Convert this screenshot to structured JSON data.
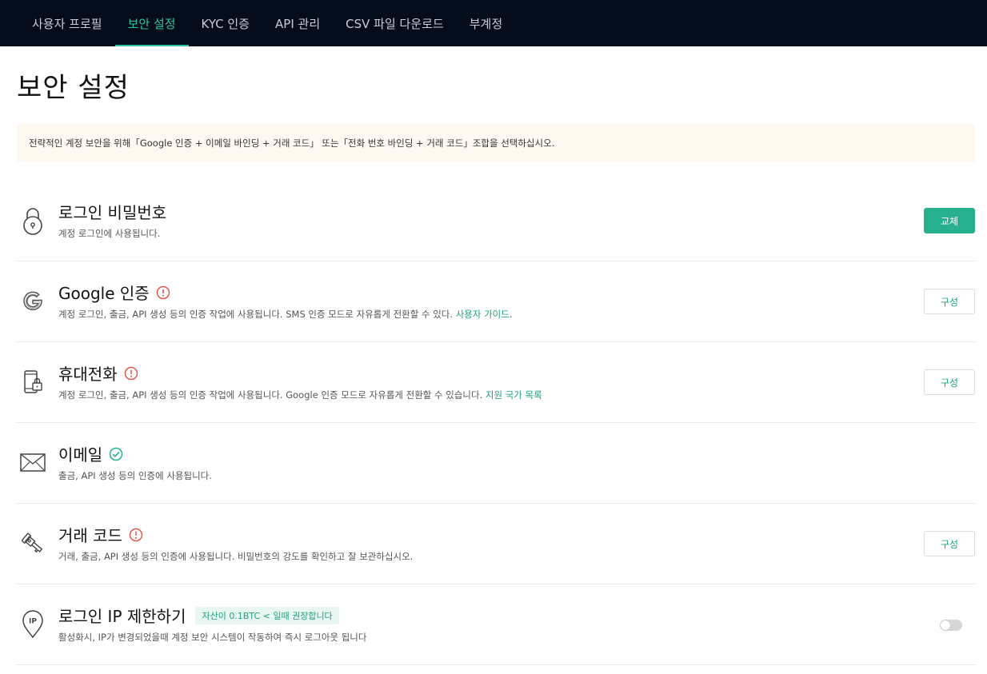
{
  "nav": {
    "tabs": [
      {
        "label": "사용자 프로필"
      },
      {
        "label": "보안 설정"
      },
      {
        "label": "KYC 인증"
      },
      {
        "label": "API 관리"
      },
      {
        "label": "CSV 파일 다운로드"
      },
      {
        "label": "부계정"
      }
    ],
    "active_index": 1
  },
  "page": {
    "title": "보안 설정",
    "notice": "전략적인 계정 보안을 위해「Google 인증 + 이메일 바인딩 + 거래 코드」 또는「전화 번호 바인딩 + 거래 코드」조합을 선택하십시오."
  },
  "settings": {
    "login_password": {
      "icon": "padlock-icon",
      "title": "로그인 비밀번호",
      "desc": "계정 로그인에 사용됩니다.",
      "button": "교체"
    },
    "google_auth": {
      "icon": "google-icon",
      "title": "Google 인증",
      "status": "warning",
      "desc": "계정 로그인, 출금, API 생성 등의 인증 작업에 사용됩니다. SMS 인증 모드로 자유롭게 전환할 수 있다.",
      "link": "사용자 가이드",
      "desc_suffix": ".",
      "button": "구성"
    },
    "phone": {
      "icon": "mobile-phone-icon",
      "title": "휴대전화",
      "status": "warning",
      "desc": "계정 로그인, 출금, API 생성 등의 인증 작업에 사용됩니다. Google 인증 모드로 자유롭게 전환할 수 있습니다.",
      "link": "지원 국가 목록",
      "button": "구성"
    },
    "email": {
      "icon": "envelope-icon",
      "title": "이메일",
      "status": "verified",
      "desc": "출금, API 생성 등의 인증에 사용됩니다."
    },
    "trade_code": {
      "icon": "key-icon",
      "title": "거래 코드",
      "status": "warning",
      "desc": "거래, 출금, API 생성 등의 인증에 사용됩니다. 비밀번호의 강도를 확인하고 잘 보관하십시오.",
      "button": "구성"
    },
    "ip_restrict": {
      "icon": "ip-location-icon",
      "title": "로그인 IP 제한하기",
      "tag": "자산이 0.1BTC < 일때 권장합니다",
      "desc": "활성화시, IP가 변경되었을때 계정 보안 시스템이 작동하여 즉시 로그아웃 됩니다",
      "enabled": false
    }
  },
  "colors": {
    "nav_bg": "#050d1c",
    "accent": "#26b08e",
    "warning": "#e05a4f",
    "notice_bg": "#fff8f0"
  }
}
